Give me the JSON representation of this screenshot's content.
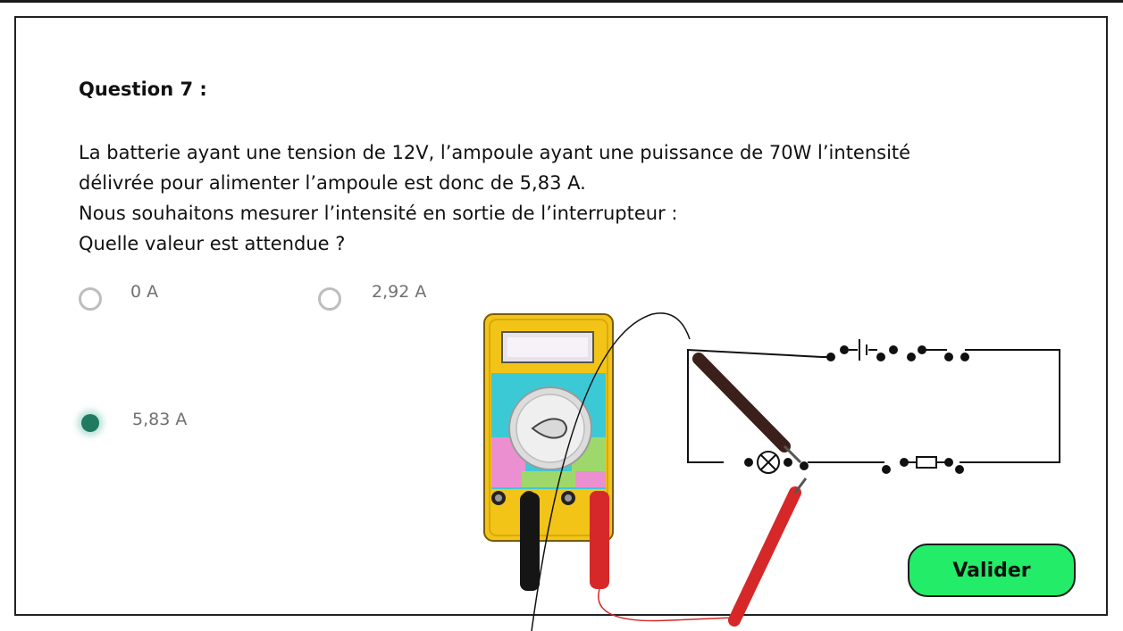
{
  "question": {
    "title": "Question 7 :",
    "lines": [
      "La batterie ayant une tension de 12V, l’ampoule ayant une puissance de 70W l’intensité",
      "délivrée pour alimenter l’ampoule est donc de 5,83 A.",
      "Nous souhaitons mesurer l’intensité en sortie de l’interrupteur :",
      "Quelle valeur est attendue ?"
    ]
  },
  "options": [
    {
      "label": "0 A",
      "selected": false
    },
    {
      "label": "2,92 A",
      "selected": false
    },
    {
      "label": "5,83 A",
      "selected": true
    }
  ],
  "submit_label": "Valider",
  "colors": {
    "accent_green": "#22ec68",
    "radio_selected": "#1f7a5f",
    "multimeter_yellow": "#f2c418",
    "probe_red": "#d62828"
  },
  "illustration": {
    "multimeter_icon": "multimeter-icon",
    "circuit_icon": "circuit-diagram-icon"
  }
}
